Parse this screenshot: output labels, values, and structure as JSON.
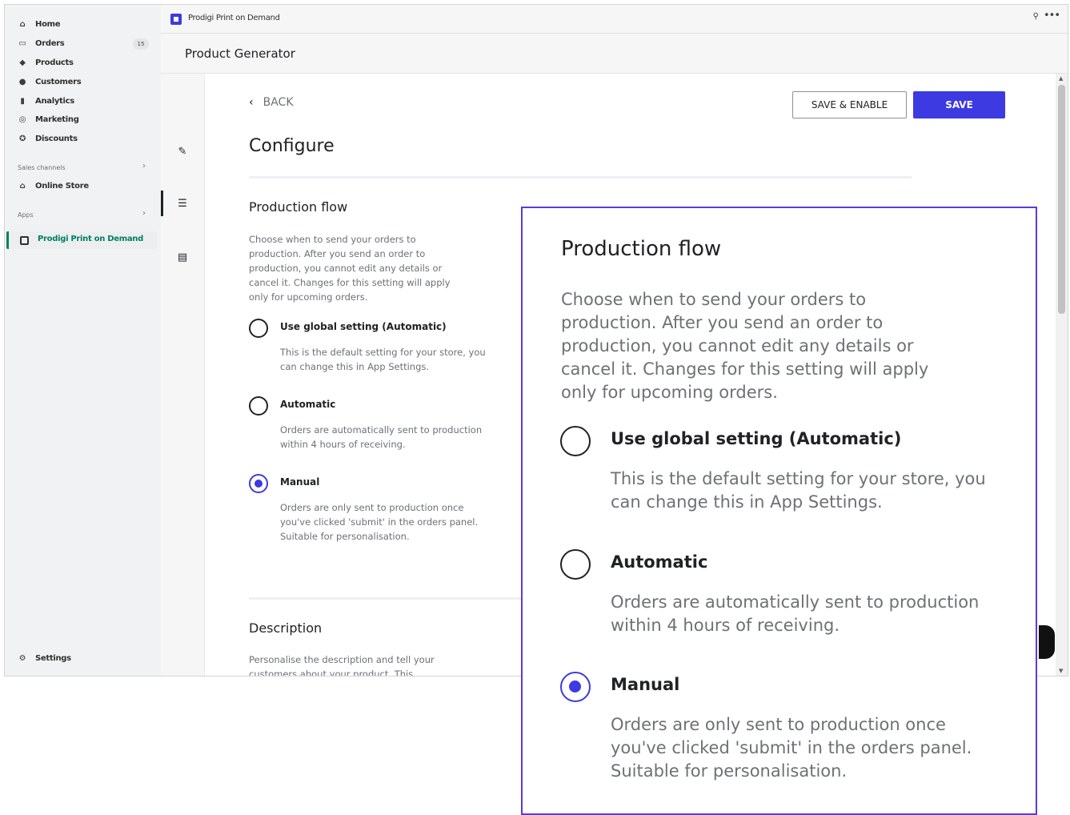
{
  "sidebar": {
    "items": [
      {
        "label": "Home",
        "icon": "home-icon"
      },
      {
        "label": "Orders",
        "icon": "orders-icon",
        "badge": "15"
      },
      {
        "label": "Products",
        "icon": "tag-icon"
      },
      {
        "label": "Customers",
        "icon": "person-icon"
      },
      {
        "label": "Analytics",
        "icon": "bar-chart-icon"
      },
      {
        "label": "Marketing",
        "icon": "target-icon"
      },
      {
        "label": "Discounts",
        "icon": "discount-icon"
      }
    ],
    "sales_channels_label": "Sales channels",
    "online_store_label": "Online Store",
    "apps_label": "Apps",
    "active_app_label": "Prodigi Print on Demand",
    "settings_label": "Settings"
  },
  "topbar": {
    "app_name": "Prodigi Print on Demand"
  },
  "subheader": {
    "title": "Product Generator"
  },
  "toolbar": {
    "back_label": "BACK",
    "save_enable_label": "SAVE & ENABLE",
    "save_label": "SAVE"
  },
  "page": {
    "title": "Configure"
  },
  "production_flow": {
    "title": "Production flow",
    "description_lines": [
      "Choose when to send your orders to",
      "production. After you send an order to",
      "production, you cannot edit any details or",
      "cancel it. Changes for this setting will apply",
      "only for upcoming orders."
    ],
    "options": [
      {
        "label": "Use global setting (Automatic)",
        "desc_lines": [
          "This is the default setting for your store, you",
          "can change this in App Settings."
        ],
        "selected": false
      },
      {
        "label": "Automatic",
        "desc_lines": [
          "Orders are automatically sent to production",
          "within 4 hours of receiving."
        ],
        "selected": false
      },
      {
        "label": "Manual",
        "desc_lines": [
          "Orders are only sent to production once",
          "you've clicked 'submit' in the orders panel.",
          "Suitable for personalisation."
        ],
        "selected": true
      }
    ]
  },
  "description_section": {
    "title": "Description",
    "text_lines": [
      "Personalise the description and tell your",
      "customers about your product. This"
    ]
  },
  "colors": {
    "accent": "#3c3ae0",
    "zoom_border": "#5b3bd6",
    "active_nav": "#008060"
  }
}
